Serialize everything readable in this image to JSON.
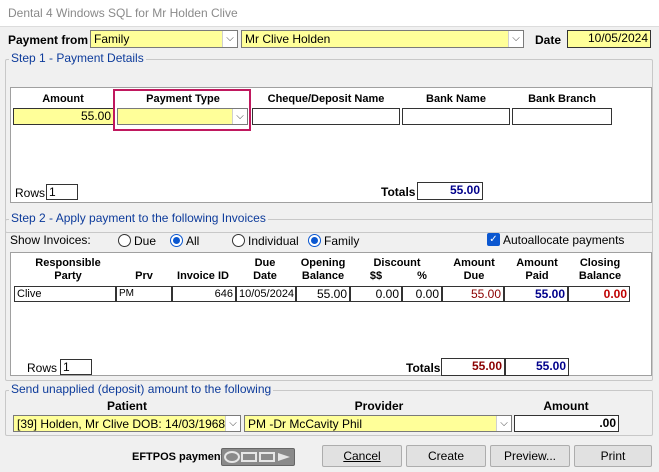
{
  "window": {
    "title": "Dental 4 Windows SQL for Mr  Holden  Clive"
  },
  "header": {
    "payment_from_label": "Payment from",
    "payment_from_value": "Family",
    "patient_value": "Mr Clive  Holden",
    "date_label": "Date",
    "date_value": "10/05/2024"
  },
  "step1": {
    "title": "Step 1 - Payment Details",
    "columns": [
      "Amount",
      "Payment Type",
      "Cheque/Deposit Name",
      "Bank Name",
      "Bank Branch"
    ],
    "amount": "55.00",
    "payment_type": "",
    "cheque_name": "",
    "bank_name": "",
    "bank_branch": "",
    "rows_label": "Rows",
    "rows_value": "1",
    "totals_label": "Totals",
    "totals_value": "55.00"
  },
  "step2": {
    "title": "Step 2 - Apply payment to the following Invoices",
    "show_invoices_label": "Show Invoices:",
    "radio_due": "Due",
    "radio_all": "All",
    "radio_individual": "Individual",
    "radio_family": "Family",
    "autoallocate_label": "Autoallocate payments",
    "headers": {
      "responsible": "Responsible",
      "party": "Party",
      "prv": "Prv",
      "invoice_id": "Invoice ID",
      "due": "Due",
      "date": "Date",
      "opening": "Opening",
      "balance": "Balance",
      "discount": "Discount",
      "dollars": "$$",
      "percent": "%",
      "amount_due_1": "Amount",
      "amount_due_2": "Due",
      "amount_paid_1": "Amount",
      "amount_paid_2": "Paid",
      "closing_1": "Closing",
      "closing_2": "Balance"
    },
    "row": {
      "party": "Clive",
      "prv": "PM",
      "invoice_id": "646",
      "due_date": "10/05/2024",
      "opening_balance": "55.00",
      "discount_dollars": "0.00",
      "discount_percent": "0.00",
      "amount_due": "55.00",
      "amount_paid": "55.00",
      "closing_balance": "0.00"
    },
    "rows_label": "Rows",
    "rows_value": "1",
    "totals_label": "Totals",
    "total_due": "55.00",
    "total_paid": "55.00"
  },
  "unapplied": {
    "title": "Send unapplied (deposit) amount to the following",
    "patient_label": "Patient",
    "provider_label": "Provider",
    "amount_label": "Amount",
    "patient_value": "[39] Holden, Mr Clive DOB: 14/03/1968",
    "provider_value": "PM -Dr McCavity Phil",
    "amount_value": ".00"
  },
  "footer": {
    "eftpos_label": "EFTPOS payment",
    "cancel": "Cancel",
    "create": "Create",
    "preview": "Preview...",
    "print": "Print"
  },
  "colors": {
    "field_yellow": "#ffff99",
    "group_title": "#0d3b9b",
    "highlight": "#c0185e"
  }
}
